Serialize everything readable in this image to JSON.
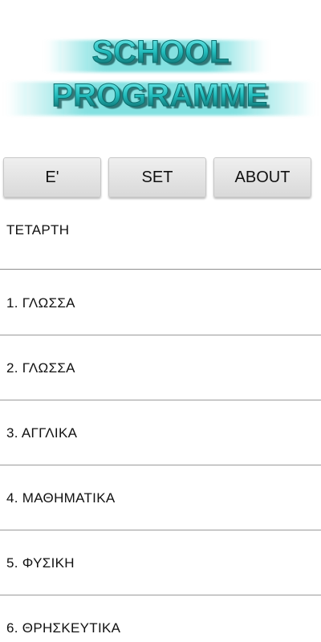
{
  "logo": {
    "line1": "SCHOOL",
    "line2": "PROGRAMME",
    "color": "#20c8c8"
  },
  "buttons": {
    "grade": "Ε'",
    "set": "SET",
    "about": "ABOUT"
  },
  "day": "ΤΕΤΑΡΤΗ",
  "lessons": [
    "1. ΓΛΩΣΣΑ",
    "2. ΓΛΩΣΣΑ",
    "3. ΑΓΓΛΙΚΑ",
    "4. ΜΑΘΗΜΑΤΙΚΑ",
    "5. ΦΥΣΙΚΗ",
    "6. ΘΡΗΣΚΕΥΤΙΚΑ"
  ]
}
